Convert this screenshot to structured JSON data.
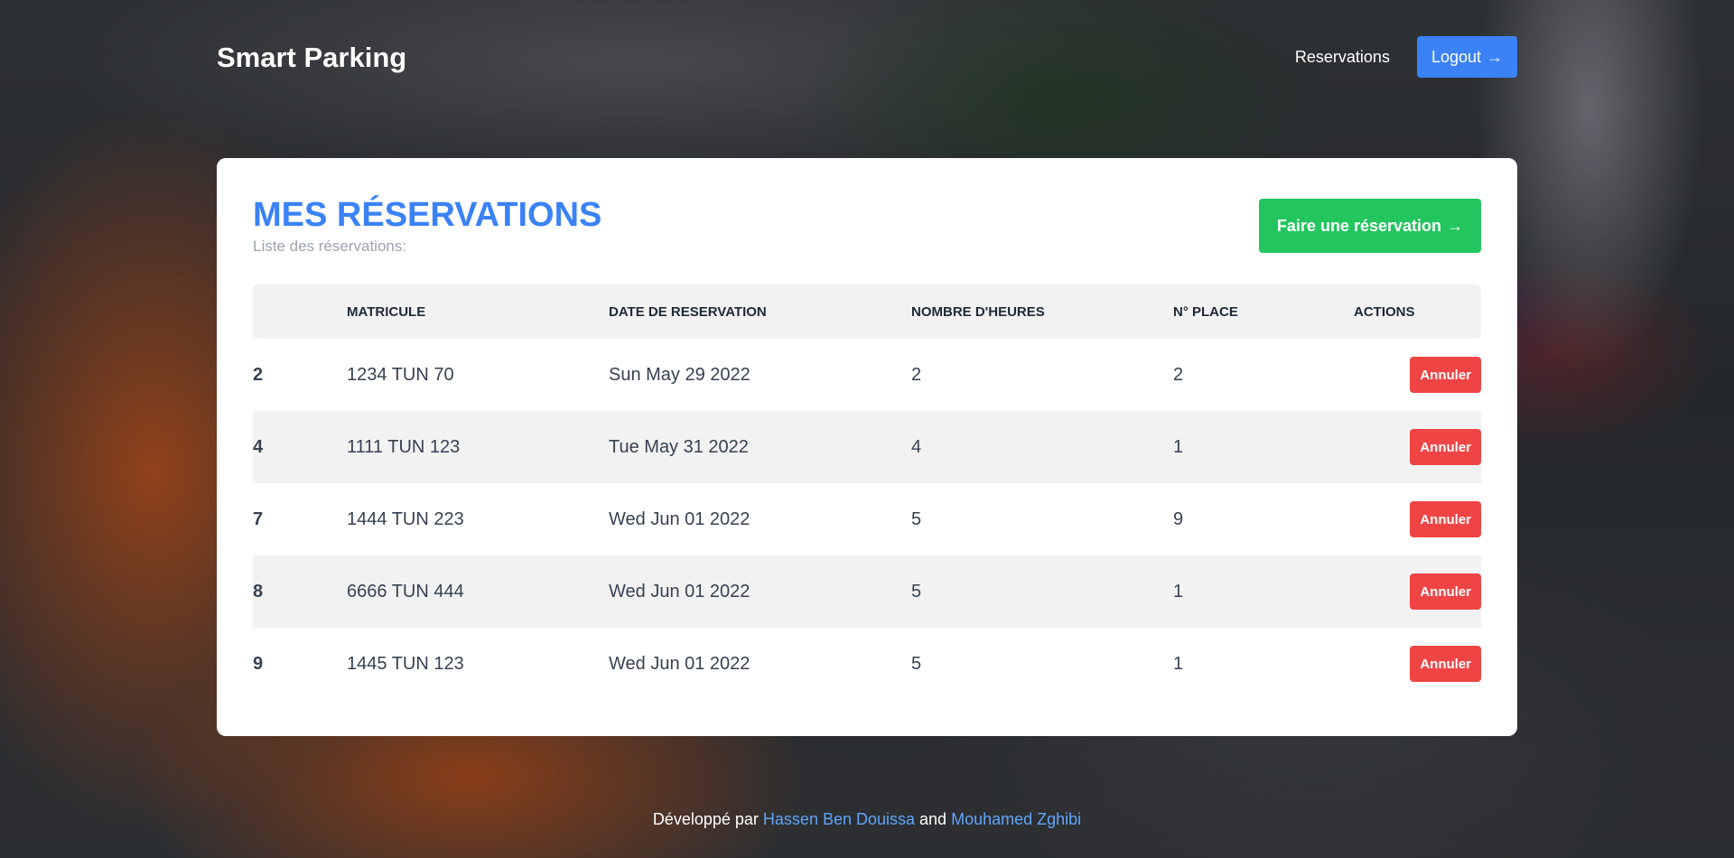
{
  "header": {
    "brand": "Smart Parking",
    "nav_reservations": "Reservations",
    "logout_label": "Logout",
    "logout_arrow": "→"
  },
  "main": {
    "title": "MES RÉSERVATIONS",
    "subtitle": "Liste des réservations:",
    "new_button_label": "Faire une réservation",
    "new_button_arrow": "→"
  },
  "table": {
    "headers": [
      "",
      "MATRICULE",
      "DATE DE RESERVATION",
      "NOMBRE D'HEURES",
      "N° PLACE",
      "ACTIONS"
    ],
    "rows": [
      {
        "id": "2",
        "matricule": "1234 TUN 70",
        "date": "Sun May 29 2022",
        "hours": "2",
        "place": "2",
        "action": "Annuler"
      },
      {
        "id": "4",
        "matricule": "1111 TUN 123",
        "date": "Tue May 31 2022",
        "hours": "4",
        "place": "1",
        "action": "Annuler"
      },
      {
        "id": "7",
        "matricule": "1444 TUN 223",
        "date": "Wed Jun 01 2022",
        "hours": "5",
        "place": "9",
        "action": "Annuler"
      },
      {
        "id": "8",
        "matricule": "6666 TUN 444",
        "date": "Wed Jun 01 2022",
        "hours": "5",
        "place": "1",
        "action": "Annuler"
      },
      {
        "id": "9",
        "matricule": "1445 TUN 123",
        "date": "Wed Jun 01 2022",
        "hours": "5",
        "place": "1",
        "action": "Annuler"
      }
    ]
  },
  "footer": {
    "prefix": "Développé par",
    "author1": "Hassen Ben Douissa",
    "connector": "and",
    "author2": "Mouhamed Zghibi"
  },
  "colors": {
    "primary": "#3b82f6",
    "success": "#22c55e",
    "danger": "#ef4444",
    "link": "#60a5fa"
  }
}
